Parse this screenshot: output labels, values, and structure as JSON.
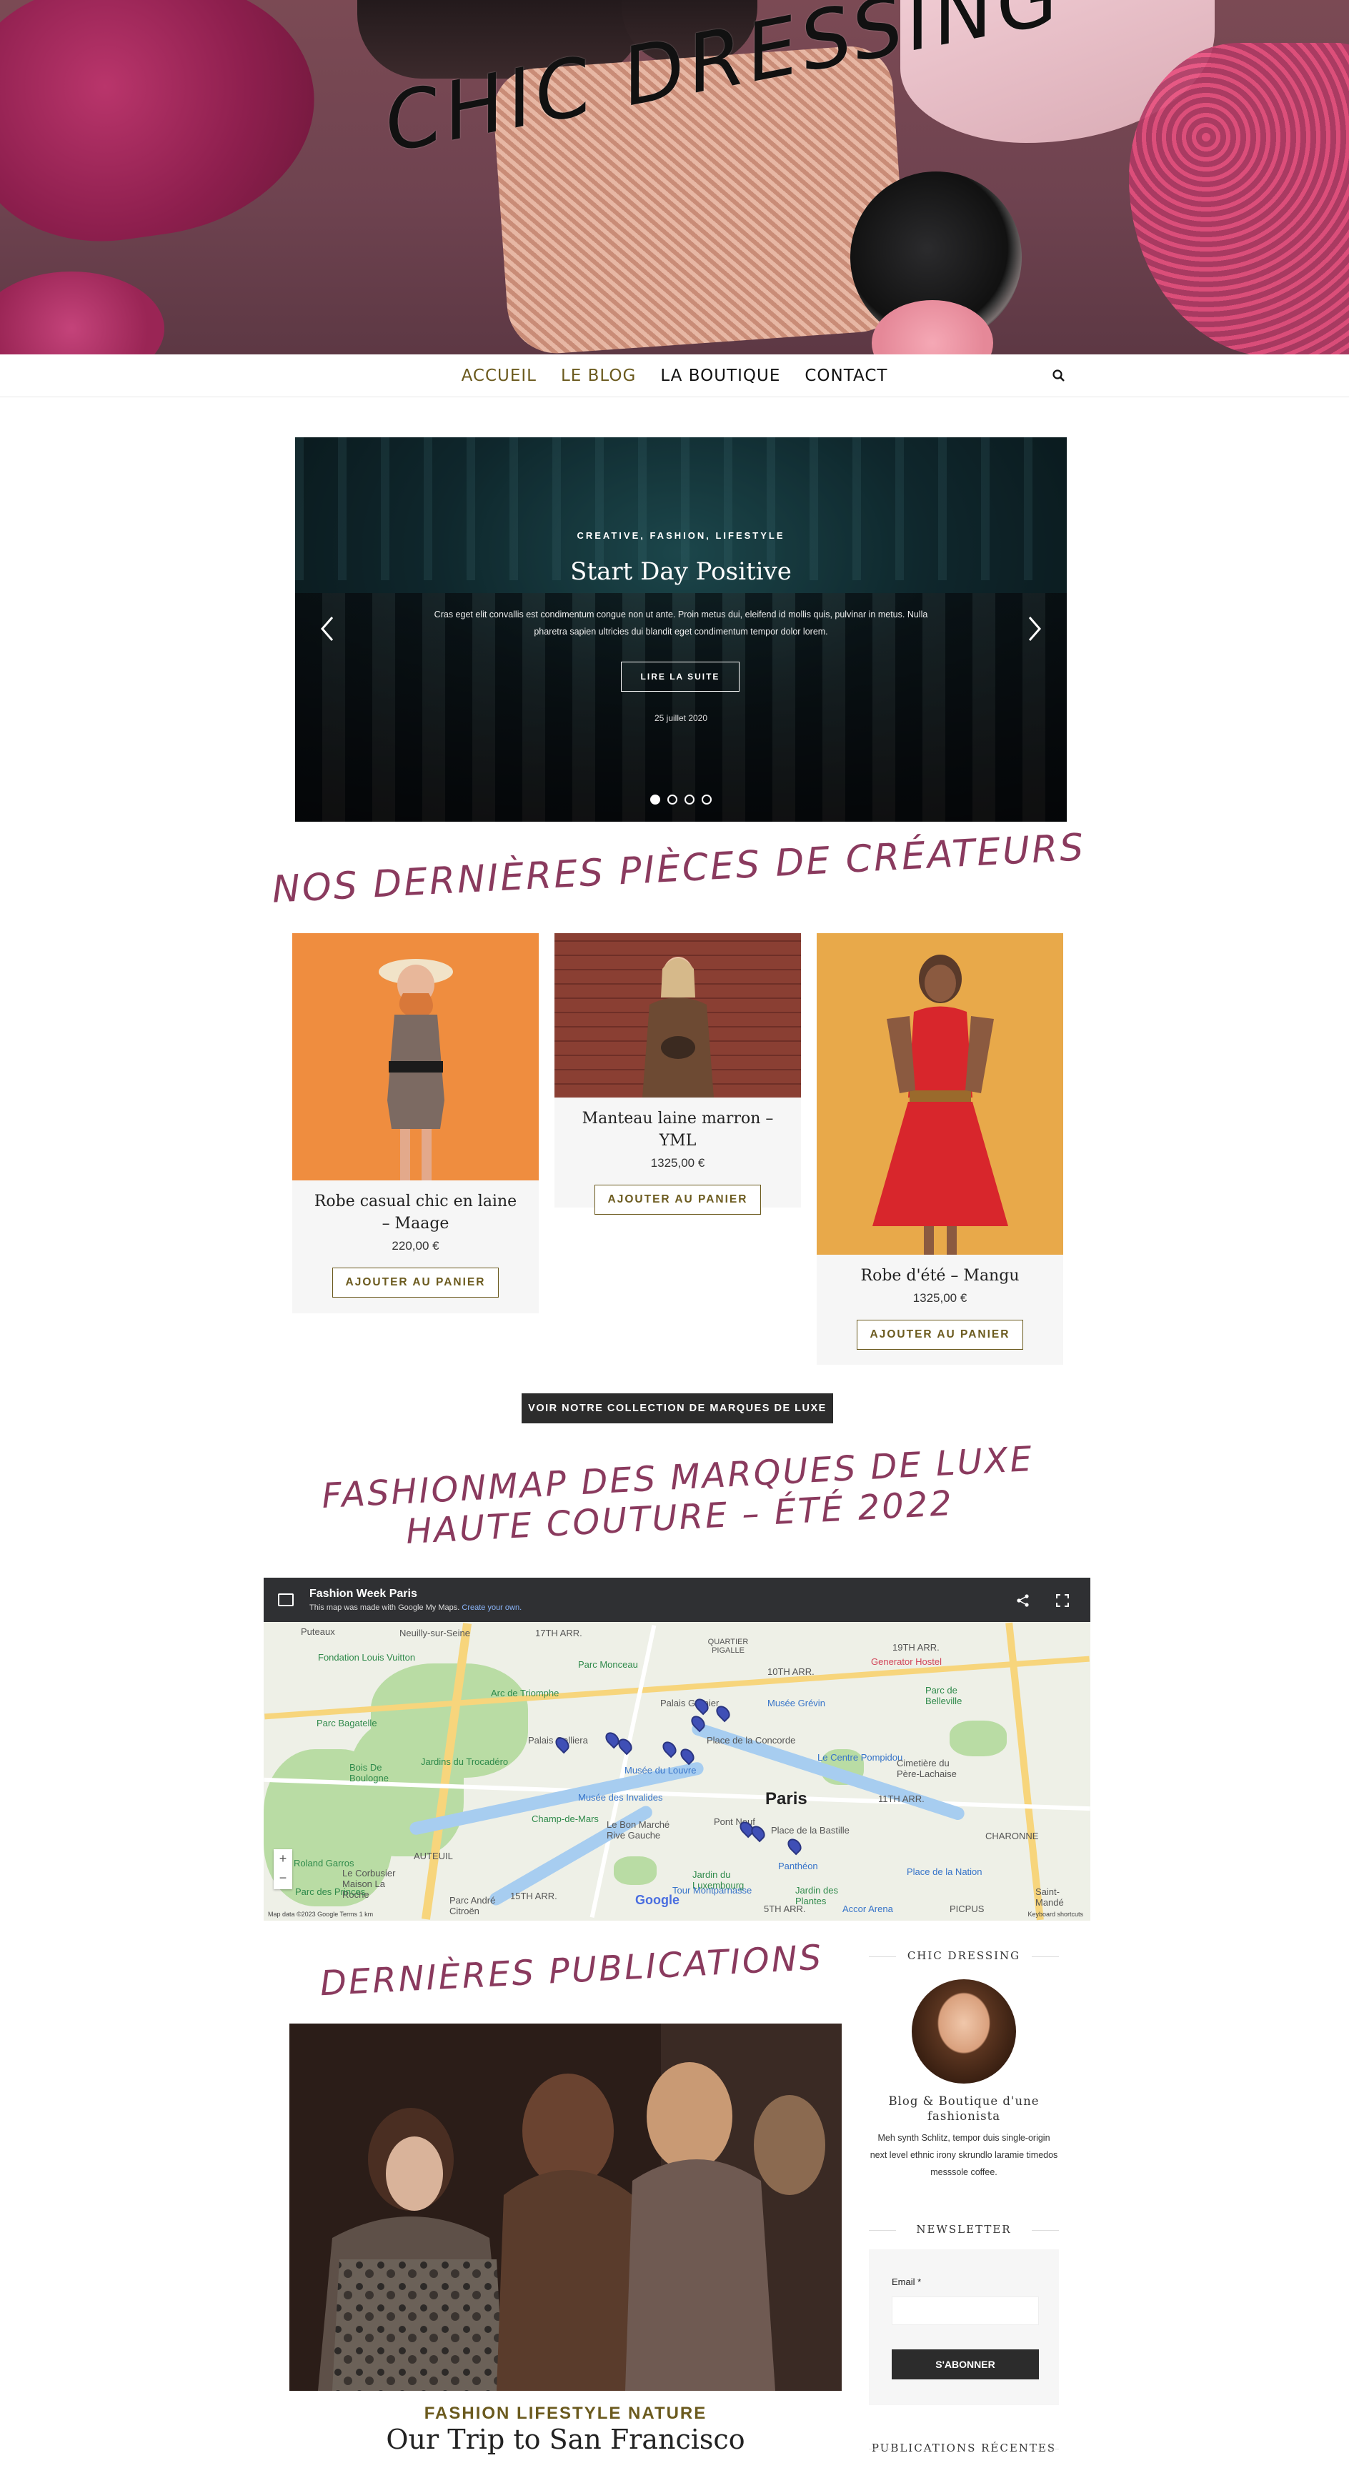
{
  "hero": {
    "title": "CHIC DRESSING"
  },
  "nav": {
    "items": [
      {
        "label": "ACCUEIL"
      },
      {
        "label": "LE BLOG"
      },
      {
        "label": "LA BOUTIQUE"
      },
      {
        "label": "CONTACT"
      }
    ],
    "search_icon": "search-icon"
  },
  "slider": {
    "categories": "CREATIVE, FASHION, LIFESTYLE",
    "title": "Start Day Positive",
    "excerpt": "Cras eget elit convallis est condimentum congue non ut ante. Proin metus dui, eleifend id mollis quis, pulvinar in metus. Nulla pharetra sapien ultricies dui blandit eget condimentum tempor dolor lorem.",
    "button": "LIRE LA SUITE",
    "date": "25 juillet 2020",
    "dots": 4,
    "active_dot": 1
  },
  "designers": {
    "title": "NOS DERNIÈRES PIÈCES DE CRÉATEURS",
    "products": [
      {
        "name": "Robe casual chic en laine – Maage",
        "price": "220,00 €",
        "button": "AJOUTER AU PANIER"
      },
      {
        "name": "Manteau laine marron – YML",
        "price": "1325,00 €",
        "button": "AJOUTER AU PANIER"
      },
      {
        "name": "Robe d'été – Mangu",
        "price": "1325,00 €",
        "button": "AJOUTER AU PANIER"
      }
    ],
    "collection_button": "VOIR NOTRE COLLECTION DE MARQUES DE LUXE"
  },
  "fashionmap": {
    "title_line1": "FASHIONMAP DES MARQUES DE LUXE",
    "title_line2": "HAUTE COUTURE – ÉTÉ 2022",
    "map_title": "Fashion Week Paris",
    "map_subtitle": "This map was made with Google My Maps.",
    "map_subtitle_link": "Create your own.",
    "labels": {
      "puteaux": "Puteaux",
      "neuilly": "Neuilly-sur-Seine",
      "arr17": "17TH ARR.",
      "pigalle": "QUARTIER PIGALLE",
      "arr19": "19TH ARR.",
      "arr10": "10TH ARR.",
      "parc_monceau": "Parc Monceau",
      "fondation": "Fondation Louis Vuitton",
      "arc": "Arc de Triomphe",
      "bagatelle": "Parc Bagatelle",
      "palais_garnier": "Palais Garnier",
      "musee_grevin": "Musée Grévin",
      "parc_belleville": "Parc de Belleville",
      "palais_galliera": "Palais Galliera",
      "concorde": "Place de la Concorde",
      "pompidou": "Le Centre Pompidou",
      "bois_boulogne": "Bois De Boulogne",
      "trocadero": "Jardins du Trocadéro",
      "louvre": "Musée du Louvre",
      "pere_lachaise": "Cimetière du Père-Lachaise",
      "paris": "Paris",
      "arr11": "11TH ARR.",
      "invalides": "Musée des Invalides",
      "champ": "Champ-de-Mars",
      "bon_marche": "Le Bon Marché Rive Gauche",
      "pont_neuf": "Pont Neuf",
      "bastille": "Place de la Bastille",
      "charonne": "CHARONNE",
      "roland_garros": "Roland Garros",
      "auteuil": "AUTEUIL",
      "corbusier": "Le Corbusier Maison La Roche",
      "pantheon": "Panthéon",
      "nation": "Place de la Nation",
      "luxembourg": "Jardin du Luxembourg",
      "parc_princes": "Parc des Princes",
      "arr15": "15TH ARR.",
      "montparnasse": "Tour Montparnasse",
      "arr5": "5TH ARR.",
      "jardin_plantes": "Jardin des Plantes",
      "accor": "Accor Arena",
      "picpus": "PICPUS",
      "parc_andre": "Parc André Citroën",
      "saint_mande": "Saint-Mandé",
      "generator": "Generator Hostel"
    },
    "footer_left": "Map data ©2023 Google",
    "footer_terms": "Terms",
    "footer_scale": "1 km",
    "footer_right": "Keyboard shortcuts",
    "google": "Google"
  },
  "publications": {
    "title": "DERNIÈRES PUBLICATIONS",
    "post_tags": "FASHION LIFESTYLE NATURE",
    "post_title": "Our Trip to San Francisco"
  },
  "sidebar": {
    "about_title": "CHIC DRESSING",
    "tagline": "Blog & Boutique d'une fashionista",
    "text": "Meh synth Schlitz, tempor duis single-origin next level ethnic irony skrundlo laramie timedos messsole coffee.",
    "newsletter_title": "NEWSLETTER",
    "email_label": "Email *",
    "subscribe": "S'ABONNER",
    "recent_title": "PUBLICATIONS RÉCENTES"
  },
  "colors": {
    "accent_gold": "#6b5a1e",
    "accent_rose": "#8a3a5e",
    "dark_button": "#2c2c2c"
  }
}
